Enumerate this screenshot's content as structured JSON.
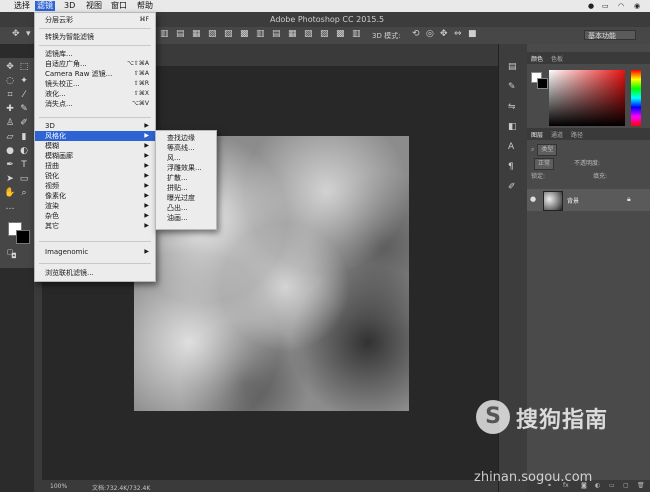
{
  "menubar": {
    "items": [
      "选择",
      "滤镜",
      "3D",
      "视图",
      "窗口",
      "帮助"
    ],
    "active": "滤镜",
    "right_icons": [
      "wechat-icon",
      "battery-icon",
      "wifi-icon",
      "volume-icon"
    ]
  },
  "window": {
    "title": "Adobe Photoshop CC 2015.5"
  },
  "options_bar": {
    "mode_3d_label": "3D 模式:",
    "workspace": "基本功能"
  },
  "filter_menu": {
    "last_filter": {
      "label": "分层云彩",
      "shortcut": "⌘F"
    },
    "smart": {
      "label": "转换为智能滤镜"
    },
    "group1": [
      {
        "label": "滤镜库...",
        "shortcut": ""
      },
      {
        "label": "自适应广角...",
        "shortcut": "⌥⇧⌘A"
      },
      {
        "label": "Camera Raw 滤镜...",
        "shortcut": "⇧⌘A"
      },
      {
        "label": "镜头校正...",
        "shortcut": "⇧⌘R"
      },
      {
        "label": "液化...",
        "shortcut": "⇧⌘X"
      },
      {
        "label": "消失点...",
        "shortcut": "⌥⌘V"
      }
    ],
    "group2": [
      "3D",
      "风格化",
      "模糊",
      "模糊画廊",
      "扭曲",
      "锐化",
      "视频",
      "像素化",
      "渲染",
      "杂色",
      "其它"
    ],
    "highlighted": "风格化",
    "imagenomic": "Imagenomic",
    "browse": "浏览联机滤镜..."
  },
  "stylize_submenu": {
    "items": [
      "查找边缘",
      "等高线...",
      "风...",
      "浮雕效果...",
      "扩散...",
      "拼贴...",
      "曝光过度",
      "凸出...",
      "油画..."
    ]
  },
  "status": {
    "zoom": "100%",
    "doc": "文档:732.4K/732.4K"
  },
  "panels": {
    "color_tabs": [
      "颜色",
      "色板"
    ],
    "layer_tabs": [
      "图层",
      "通道",
      "路径"
    ],
    "kind_label": "类型",
    "blend_mode": "正常",
    "opacity_label": "不透明度:",
    "lock_label": "锁定:",
    "fill_label": "填充:",
    "layer_name": "背景"
  },
  "watermark": {
    "logo_glyph": "S",
    "brand": "搜狗指南",
    "url": "zhinan.sogou.com"
  }
}
